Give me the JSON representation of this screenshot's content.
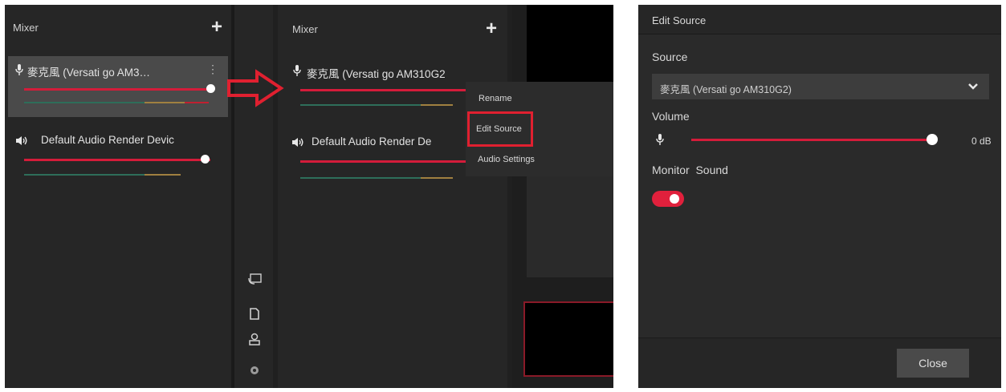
{
  "left_panel": {
    "title": "Mixer",
    "add_symbol": "+",
    "sources": [
      {
        "label": "麥克風 (Versati go AM3…",
        "more": "⋮"
      },
      {
        "label": "Default Audio Render Devic"
      }
    ]
  },
  "middle_panel": {
    "title": "Mixer",
    "add_symbol": "+",
    "sources": [
      {
        "label": "麥克風 (Versati go AM310G2"
      },
      {
        "label": "Default Audio Render De"
      }
    ],
    "context_menu": [
      "Rename",
      "Edit Source",
      "Audio Settings"
    ],
    "highlighted_item": "Edit Source"
  },
  "dialog": {
    "title": "Edit Source",
    "source_label": "Source",
    "source_value": "麥克風 (Versati go AM310G2)",
    "volume_label": "Volume",
    "volume_value": "0 dB",
    "volume_level_fraction": 1.0,
    "monitor_label": "Monitor  Sound",
    "monitor_on": true,
    "close_label": "Close"
  },
  "colors": {
    "accent_red": "#e0203c",
    "panel_bg": "#262626",
    "meter_green": "#2e6e5a",
    "meter_yellow": "#a08040"
  }
}
